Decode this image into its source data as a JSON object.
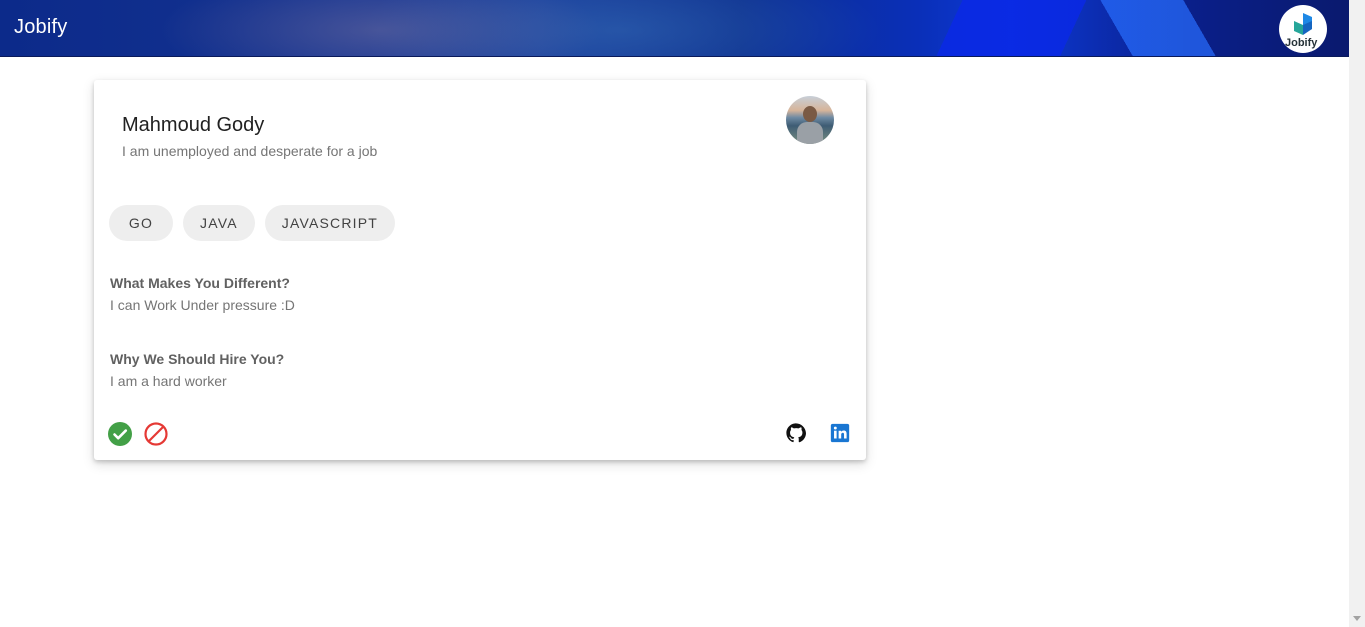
{
  "app": {
    "title": "Jobify",
    "logo_text": "Jobify"
  },
  "card": {
    "name": "Mahmoud Gody",
    "tagline": "I am unemployed and desperate for a job",
    "skills": [
      "GO",
      "JAVA",
      "JAVASCRIPT"
    ],
    "questions": [
      {
        "question": "What Makes You Different?",
        "answer": "I can Work Under pressure :D"
      },
      {
        "question": "Why We Should Hire You?",
        "answer": "I am a hard worker"
      }
    ],
    "actions": {
      "accept_icon": "check-circle-icon",
      "reject_icon": "block-icon"
    },
    "social": {
      "github_icon": "github-icon",
      "linkedin_icon": "linkedin-icon"
    }
  },
  "colors": {
    "accept": "#43a047",
    "reject": "#e53935",
    "linkedin": "#1976d2",
    "header": "#0d2f8f"
  }
}
